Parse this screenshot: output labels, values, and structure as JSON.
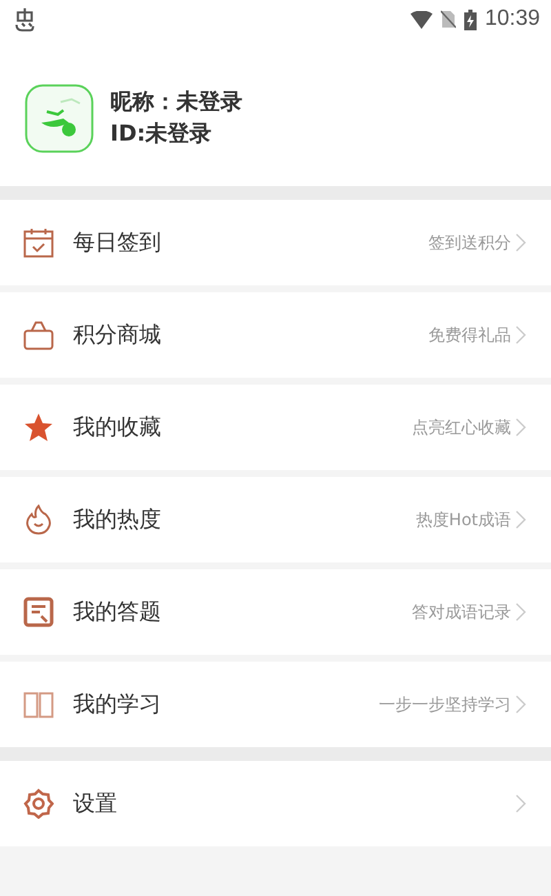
{
  "status_bar": {
    "time": "10:39"
  },
  "profile": {
    "nickname": "昵称：未登录",
    "id": "ID:未登录"
  },
  "menu": [
    {
      "kind": "calendar",
      "label": "每日签到",
      "hint": "签到送积分"
    },
    {
      "kind": "bag",
      "label": "积分商城",
      "hint": "免费得礼品"
    },
    {
      "kind": "star",
      "label": "我的收藏",
      "hint": "点亮红心收藏"
    },
    {
      "kind": "flame",
      "label": "我的热度",
      "hint": "热度Hot成语"
    },
    {
      "kind": "note",
      "label": "我的答题",
      "hint": "答对成语记录"
    },
    {
      "kind": "book",
      "label": "我的学习",
      "hint": "一步一步坚持学习"
    }
  ],
  "settings": [
    {
      "kind": "gear",
      "label": "设置"
    }
  ]
}
